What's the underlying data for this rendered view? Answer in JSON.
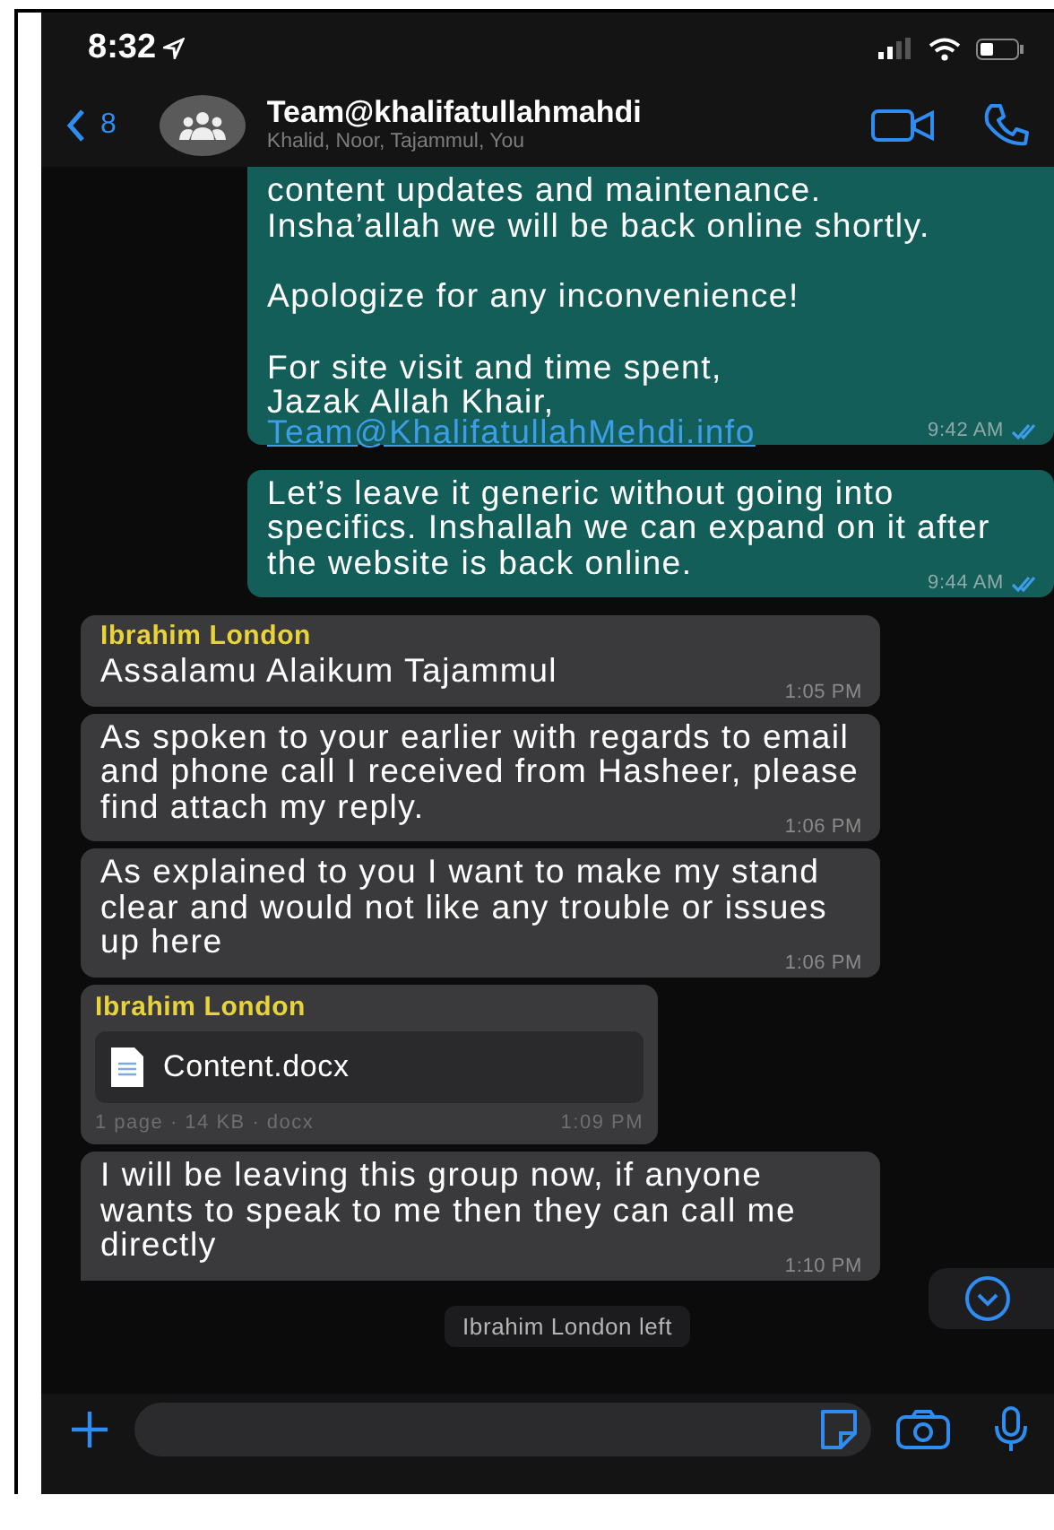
{
  "status_bar": {
    "time": "8:32"
  },
  "header": {
    "back_count": "8",
    "title": "Team@khalifatullahmahdi",
    "subtitle": "Khalid, Noor, Tajammul, You"
  },
  "messages": [
    {
      "kind": "outgoing",
      "paragraphs": [
        "content updates and maintenance.\nInsha’allah we will be back online shortly.",
        "Apologize for any inconvenience!",
        "For site visit and time spent,\nJazak Allah Khair,"
      ],
      "link": "Team@KhalifatullahMehdi.info",
      "time": "9:42 AM",
      "read": true,
      "cut_top": true
    },
    {
      "kind": "outgoing",
      "paragraphs": [
        "Let’s leave it generic without going into specifics. Inshallah we can expand on it after the website is back online."
      ],
      "time": "9:44 AM",
      "read": true,
      "cut_top": false
    },
    {
      "kind": "incoming",
      "sender": "Ibrahim London",
      "paragraphs": [
        "Assalamu Alaikum Tajammul"
      ],
      "time": "1:05 PM"
    },
    {
      "kind": "incoming",
      "paragraphs": [
        "As spoken to your earlier with regards to email and phone call I received from Hasheer, please find attach my reply."
      ],
      "time": "1:06 PM"
    },
    {
      "kind": "incoming",
      "paragraphs": [
        "As explained to you I want to make my stand clear and would not like any trouble or issues up here"
      ],
      "time": "1:06 PM"
    },
    {
      "kind": "document",
      "sender": "Ibrahim London",
      "file_name": "Content.docx",
      "meta": "1 page · 14 KB · docx",
      "time": "1:09 PM"
    },
    {
      "kind": "incoming",
      "paragraphs": [
        "I will be leaving this group now, if anyone wants to speak to me then they can call me directly"
      ],
      "time": "1:10 PM",
      "tail": true
    },
    {
      "kind": "system",
      "text": "Ibrahim London left"
    }
  ]
}
